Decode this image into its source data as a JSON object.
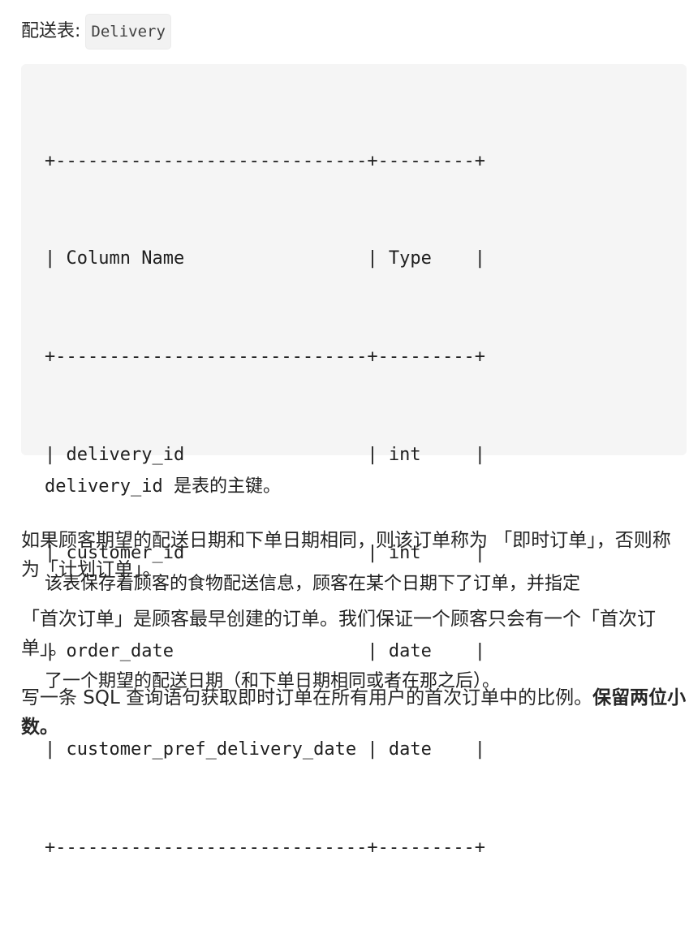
{
  "heading": {
    "label": "配送表: ",
    "table_name": "Delivery"
  },
  "schema": {
    "border": "+-----------------------------+---------+",
    "header_row": "| Column Name                 | Type    |",
    "rows": [
      "| delivery_id                 | int     |",
      "| customer_id                 | int     |",
      "| order_date                  | date    |",
      "| customer_pref_delivery_date | date    |"
    ],
    "note_primary_key": "delivery_id 是表的主键。",
    "note_line_1": "该表保存着顾客的食物配送信息，顾客在某个日期下了订单，并指定",
    "note_line_2": "了一个期望的配送日期（和下单日期相同或者在那之后）。"
  },
  "paragraphs": {
    "p1": "如果顾客期望的配送日期和下单日期相同，则该订单称为 「即时订单」，否则称为「计划订单」。",
    "p2": "「首次订单」是顾客最早创建的订单。我们保证一个顾客只会有一个「首次订单」。",
    "p3_text": "写一条 SQL 查询语句获取即时订单在所有用户的首次订单中的比例。",
    "p3_bold": "保留两位小数。"
  }
}
